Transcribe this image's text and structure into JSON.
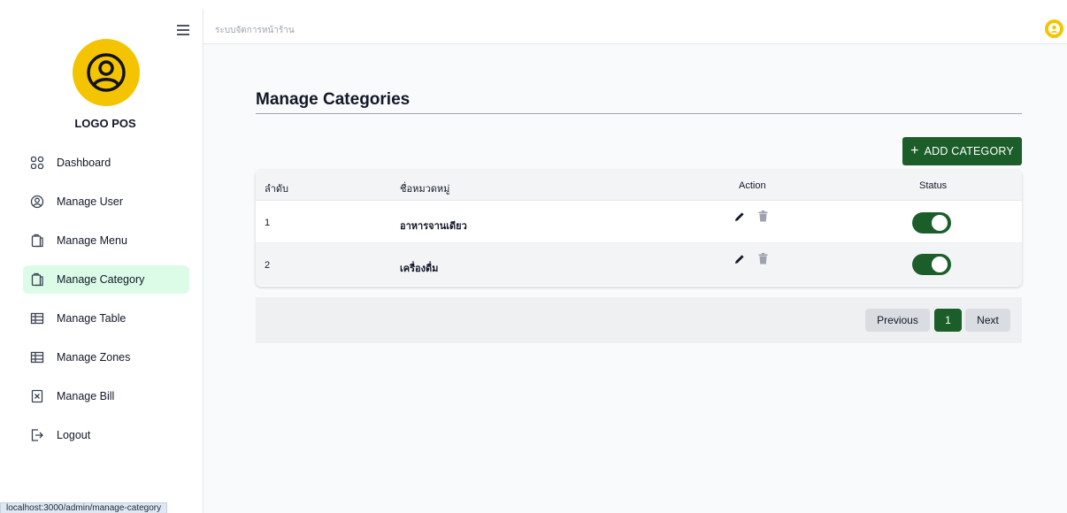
{
  "app": {
    "logo_text": "LOGO POS",
    "header_title": "ระบบจัดการหน้าร้าน"
  },
  "sidebar": {
    "items": [
      {
        "label": "Dashboard",
        "icon": "dashboard-icon"
      },
      {
        "label": "Manage User",
        "icon": "user-circle-icon"
      },
      {
        "label": "Manage Menu",
        "icon": "menu-clipboard-icon"
      },
      {
        "label": "Manage Category",
        "icon": "category-clipboard-icon",
        "active": true
      },
      {
        "label": "Manage Table",
        "icon": "table-grid-icon"
      },
      {
        "label": "Manage Zones",
        "icon": "zones-grid-icon"
      },
      {
        "label": "Manage Bill",
        "icon": "bill-icon"
      },
      {
        "label": "Logout",
        "icon": "logout-icon"
      }
    ]
  },
  "main": {
    "page_title": "Manage Categories",
    "add_button_label": "ADD CATEGORY",
    "table": {
      "columns": [
        "ลำดับ",
        "ชื่อหมวดหมู่",
        "Action",
        "Status"
      ],
      "rows": [
        {
          "index": "1",
          "name": "อาหารจานเดียว",
          "status_on": true
        },
        {
          "index": "2",
          "name": "เครื่องดื่ม",
          "status_on": true
        }
      ]
    },
    "pagination": {
      "previous_label": "Previous",
      "current_page": "1",
      "next_label": "Next"
    }
  },
  "statusbar": {
    "url": "localhost:3000/admin/manage-category"
  },
  "colors": {
    "primary_green": "#1b5e2a",
    "active_nav_bg": "#dcfce7",
    "logo_yellow": "#f5c400"
  }
}
